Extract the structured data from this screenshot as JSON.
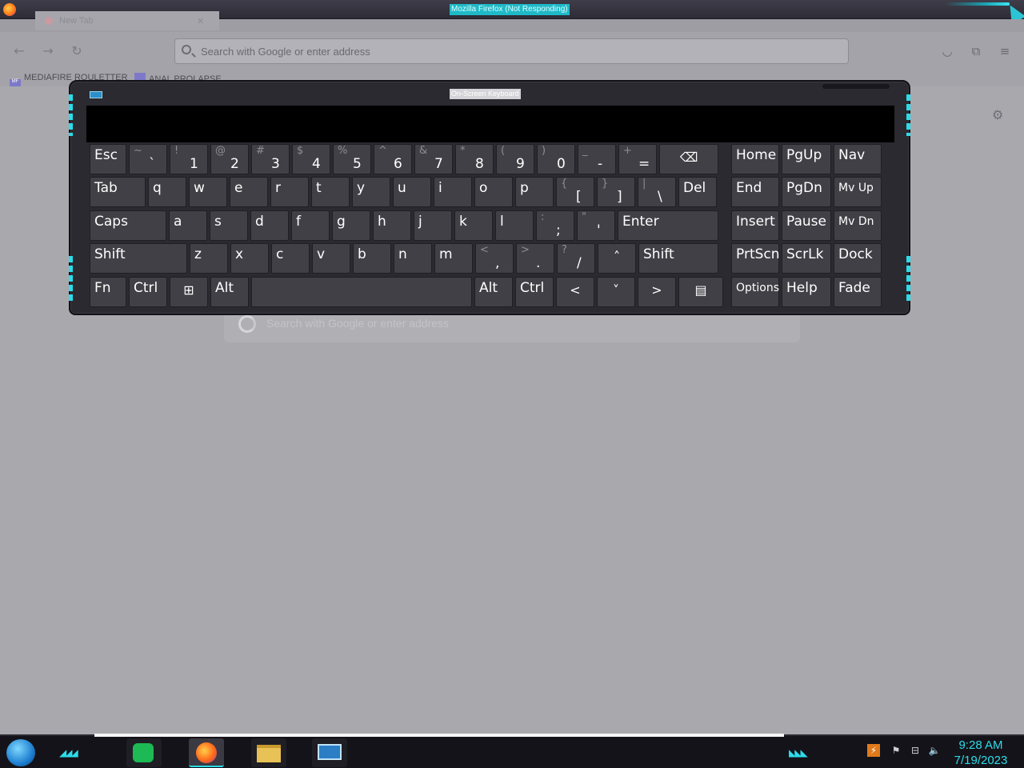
{
  "window": {
    "title": "Mozilla Firefox (Not Responding)"
  },
  "tabs": [
    {
      "label": "New Tab"
    }
  ],
  "toolbar": {
    "back_icon": "arrow-left-icon",
    "forward_icon": "arrow-right-icon",
    "reload_icon": "reload-icon",
    "url_placeholder": "Search with Google or enter address"
  },
  "bookmarks": [
    {
      "label": "MEDIAFIRE ROULETTER",
      "icon_text": "MF"
    },
    {
      "label": "ANAL PROLAPSE",
      "icon_text": ""
    }
  ],
  "page": {
    "search_placeholder": "Search with Google or enter address"
  },
  "osk": {
    "title": "On-Screen Keyboard",
    "rows": [
      [
        {
          "lbl": "Esc"
        },
        {
          "sh": "~",
          "m": "`"
        },
        {
          "sh": "!",
          "m": "1"
        },
        {
          "sh": "@",
          "m": "2"
        },
        {
          "sh": "#",
          "m": "3"
        },
        {
          "sh": "$",
          "m": "4"
        },
        {
          "sh": "%",
          "m": "5"
        },
        {
          "sh": "^",
          "m": "6"
        },
        {
          "sh": "&",
          "m": "7"
        },
        {
          "sh": "*",
          "m": "8"
        },
        {
          "sh": "(",
          "m": "9"
        },
        {
          "sh": ")",
          "m": "0"
        },
        {
          "sh": "_",
          "m": "-"
        },
        {
          "sh": "+",
          "m": "="
        },
        {
          "lbl": "⌫"
        },
        {
          "lbl": "Home"
        },
        {
          "lbl": "PgUp"
        },
        {
          "lbl": "Nav"
        }
      ],
      [
        {
          "lbl": "Tab"
        },
        {
          "lbl": "q"
        },
        {
          "lbl": "w"
        },
        {
          "lbl": "e"
        },
        {
          "lbl": "r"
        },
        {
          "lbl": "t"
        },
        {
          "lbl": "y"
        },
        {
          "lbl": "u"
        },
        {
          "lbl": "i"
        },
        {
          "lbl": "o"
        },
        {
          "lbl": "p"
        },
        {
          "sh": "{",
          "m": "["
        },
        {
          "sh": "}",
          "m": "]"
        },
        {
          "sh": "|",
          "m": "\\"
        },
        {
          "lbl": "Del"
        },
        {
          "lbl": "End"
        },
        {
          "lbl": "PgDn"
        },
        {
          "lbl": "Mv Up"
        }
      ],
      [
        {
          "lbl": "Caps"
        },
        {
          "lbl": "a"
        },
        {
          "lbl": "s"
        },
        {
          "lbl": "d"
        },
        {
          "lbl": "f"
        },
        {
          "lbl": "g"
        },
        {
          "lbl": "h"
        },
        {
          "lbl": "j"
        },
        {
          "lbl": "k"
        },
        {
          "lbl": "l"
        },
        {
          "sh": ":",
          "m": ";"
        },
        {
          "sh": "\"",
          "m": "'"
        },
        {
          "lbl": "Enter"
        },
        {
          "lbl": "Insert"
        },
        {
          "lbl": "Pause"
        },
        {
          "lbl": "Mv Dn"
        }
      ],
      [
        {
          "lbl": "Shift"
        },
        {
          "lbl": "z"
        },
        {
          "lbl": "x"
        },
        {
          "lbl": "c"
        },
        {
          "lbl": "v"
        },
        {
          "lbl": "b"
        },
        {
          "lbl": "n"
        },
        {
          "lbl": "m"
        },
        {
          "sh": "<",
          "m": ","
        },
        {
          "sh": ">",
          "m": "."
        },
        {
          "sh": "?",
          "m": "/"
        },
        {
          "lbl": "˄"
        },
        {
          "lbl": "Shift"
        },
        {
          "lbl": "PrtScn"
        },
        {
          "lbl": "ScrLk"
        },
        {
          "lbl": "Dock"
        }
      ],
      [
        {
          "lbl": "Fn"
        },
        {
          "lbl": "Ctrl"
        },
        {
          "lbl": "⊞"
        },
        {
          "lbl": "Alt"
        },
        {
          "lbl": ""
        },
        {
          "lbl": "Alt"
        },
        {
          "lbl": "Ctrl"
        },
        {
          "lbl": "<"
        },
        {
          "lbl": "˅"
        },
        {
          "lbl": ">"
        },
        {
          "lbl": "▤"
        },
        {
          "lbl": "Options"
        },
        {
          "lbl": "Help"
        },
        {
          "lbl": "Fade"
        }
      ]
    ]
  },
  "taskbar": {
    "apps": [
      "spotify-icon",
      "firefox-icon",
      "file-explorer-icon",
      "on-screen-keyboard-icon"
    ],
    "clock_time": "9:28 AM",
    "clock_date": "7/19/2023"
  },
  "colors": {
    "accent": "#2bdcea",
    "key": "#414046",
    "osk_frame": "#2b2a30"
  }
}
